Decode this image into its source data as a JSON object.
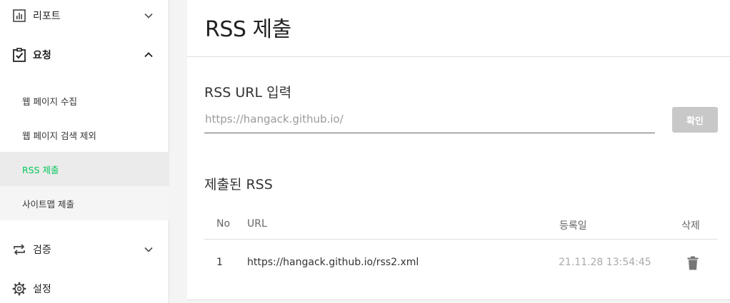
{
  "sidebar": {
    "groups": {
      "report": {
        "label": "리포트",
        "icon": "bar-chart-icon"
      },
      "request": {
        "label": "요청",
        "icon": "clipboard-check-icon"
      },
      "verify": {
        "label": "검증",
        "icon": "sync-arrows-icon"
      },
      "settings": {
        "label": "설정",
        "icon": "gear-icon"
      }
    },
    "request_items": [
      {
        "label": "웹 페이지 수집"
      },
      {
        "label": "웹 페이지 검색 제외"
      },
      {
        "label": "RSS 제출",
        "active": true
      },
      {
        "label": "사이트맵 제출"
      }
    ]
  },
  "page": {
    "title": "RSS 제출"
  },
  "input_section": {
    "title": "RSS URL 입력",
    "placeholder": "https://hangack.github.io/",
    "button_label": "확인"
  },
  "submitted": {
    "title": "제출된 RSS",
    "columns": {
      "no": "No",
      "url": "URL",
      "date": "등록일",
      "delete": "삭제"
    },
    "rows": [
      {
        "no": "1",
        "url": "https://hangack.github.io/rss2.xml",
        "date": "21.11.28 13:54:45"
      }
    ]
  },
  "colors": {
    "accent": "#03c75a",
    "button_disabled": "#c8c8c8"
  }
}
